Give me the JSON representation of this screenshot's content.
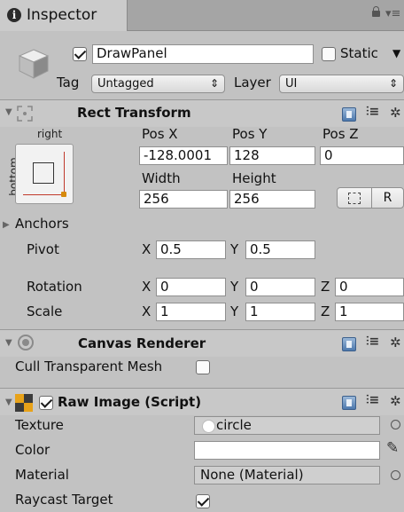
{
  "tab": {
    "title": "Inspector",
    "info_glyph": "i"
  },
  "gameobject": {
    "name": "DrawPanel",
    "active": true,
    "static_label": "Static",
    "static_checked": false,
    "tag_label": "Tag",
    "tag_value": "Untagged",
    "layer_label": "Layer",
    "layer_value": "UI"
  },
  "rect_transform": {
    "title": "Rect Transform",
    "anchor_top_label": "right",
    "anchor_side_label": "bottom",
    "pos_x_label": "Pos X",
    "pos_y_label": "Pos Y",
    "pos_z_label": "Pos Z",
    "pos_x": "-128.0001",
    "pos_y": "128",
    "pos_z": "0",
    "width_label": "Width",
    "height_label": "Height",
    "width": "256",
    "height": "256",
    "raw_button": "R",
    "anchors_label": "Anchors",
    "pivot_label": "Pivot",
    "pivot_x": "0.5",
    "pivot_y": "0.5",
    "rotation_label": "Rotation",
    "rotation_x": "0",
    "rotation_y": "0",
    "rotation_z": "0",
    "scale_label": "Scale",
    "scale_x": "1",
    "scale_y": "1",
    "scale_z": "1",
    "axis_x": "X",
    "axis_y": "Y",
    "axis_z": "Z"
  },
  "canvas_renderer": {
    "title": "Canvas Renderer",
    "cull_label": "Cull Transparent Mesh",
    "cull_checked": false
  },
  "raw_image": {
    "title": "Raw Image (Script)",
    "enabled": true,
    "texture_label": "Texture",
    "texture_value": "circle",
    "color_label": "Color",
    "color_value": "#ffffff",
    "material_label": "Material",
    "material_value": "None (Material)",
    "raycast_label": "Raycast Target",
    "raycast_checked": true
  },
  "icons": {
    "info": "info-icon",
    "lock": "lock-icon",
    "menu": "menu-icon",
    "cube": "gameobject-cube-icon",
    "rect": "rect-transform-icon",
    "canvas": "canvas-renderer-icon",
    "rawimage": "raw-image-icon",
    "help": "help-book-icon",
    "presets": "presets-sliders-icon",
    "settings": "gear-icon",
    "picker": "object-picker-icon",
    "eyedropper": "eyedropper-icon"
  }
}
